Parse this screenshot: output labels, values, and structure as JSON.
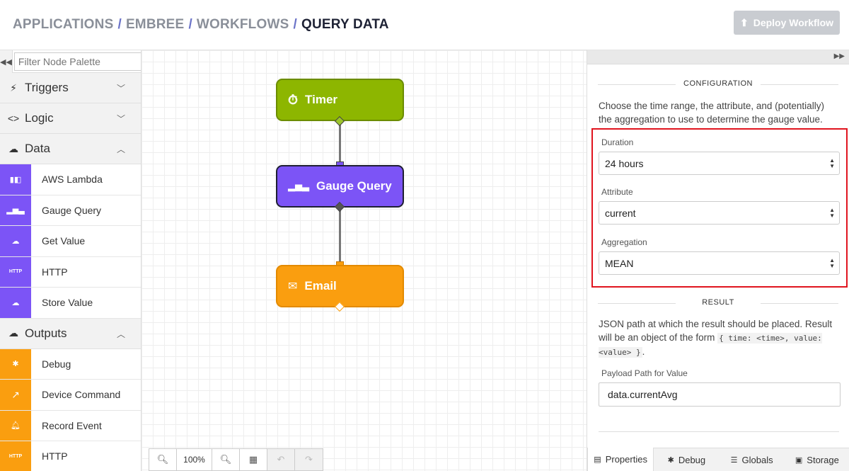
{
  "breadcrumb": {
    "items": [
      "APPLICATIONS",
      "EMBREE",
      "WORKFLOWS"
    ],
    "current": "QUERY DATA",
    "separator": "/"
  },
  "header": {
    "deploy_label": "Deploy Workflow",
    "deploy_icon": "upload-icon"
  },
  "palette": {
    "filter_placeholder": "Filter Node Palette",
    "categories": {
      "triggers": "Triggers",
      "logic": "Logic",
      "data": "Data",
      "outputs": "Outputs"
    },
    "data_items": [
      "AWS Lambda",
      "Gauge Query",
      "Get Value",
      "HTTP",
      "Store Value"
    ],
    "output_items": [
      "Debug",
      "Device Command",
      "Record Event",
      "HTTP"
    ],
    "http_icon_text": "HTTP"
  },
  "canvas": {
    "nodes": {
      "timer": "Timer",
      "gauge": "Gauge Query",
      "email": "Email"
    },
    "colors": {
      "timer": "#8db600",
      "gauge": "#7c54f6",
      "email": "#fa9e0f"
    },
    "zoom_level": "100%"
  },
  "config": {
    "configuration_title": "CONFIGURATION",
    "configuration_desc": "Choose the time range, the attribute, and (potentially) the aggregation to use to determine the gauge value.",
    "duration_label": "Duration",
    "duration_value": "24 hours",
    "attribute_label": "Attribute",
    "attribute_value": "current",
    "aggregation_label": "Aggregation",
    "aggregation_value": "MEAN",
    "result_title": "RESULT",
    "result_desc_1": "JSON path at which the result should be placed. Result will be an object of the form",
    "result_code": "{ time: <time>, value: <value> }",
    "result_desc_2": ".",
    "payload_label": "Payload Path for Value",
    "payload_value": "data.currentAvg"
  },
  "tabs": [
    "Properties",
    "Debug",
    "Globals",
    "Storage"
  ],
  "highlight_color": "#e0141e"
}
